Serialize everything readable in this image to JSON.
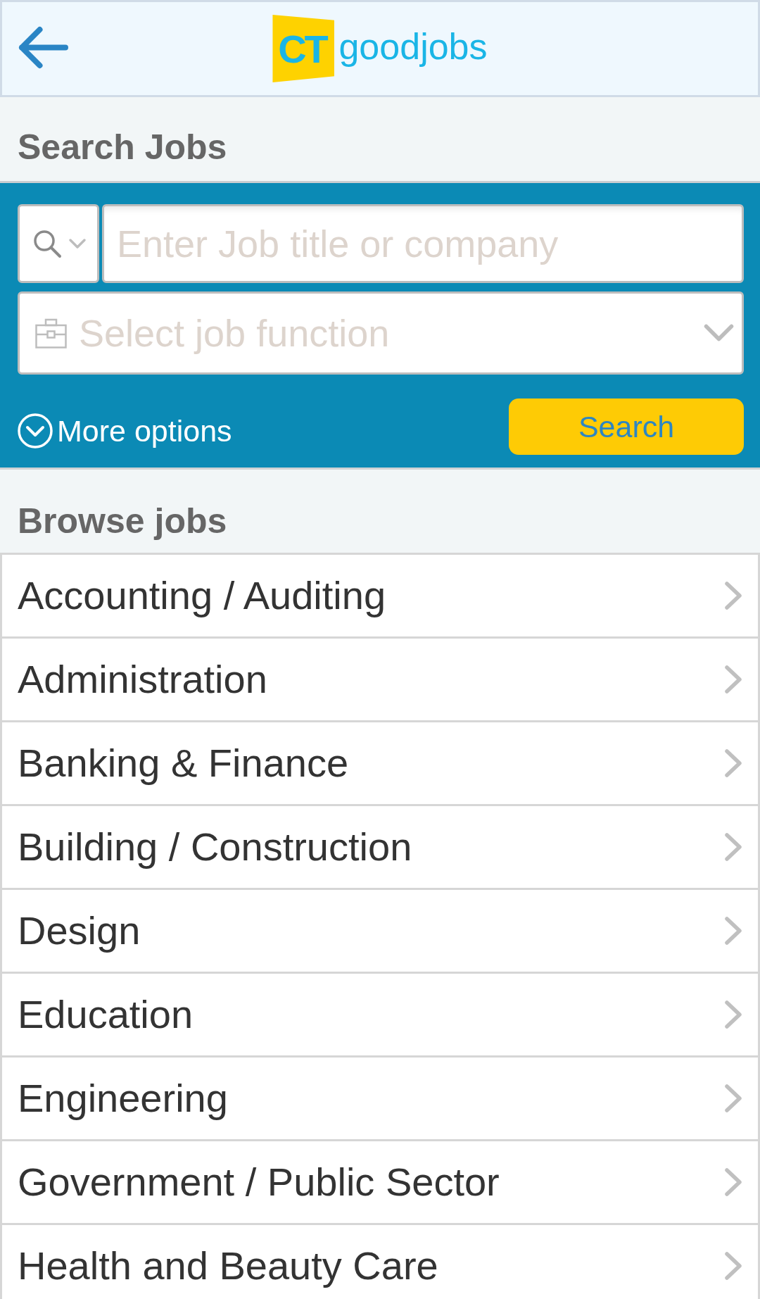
{
  "header": {
    "logo": {
      "mark": "CT",
      "wordmark": "goodjobs"
    }
  },
  "search_jobs": {
    "title": "Search Jobs",
    "keyword_field": {
      "placeholder": "Enter Job title or company"
    },
    "job_function_select": {
      "placeholder": "Select job function"
    },
    "more_options": "More options",
    "search_button": "Search"
  },
  "browse_jobs": {
    "title": "Browse jobs",
    "items": [
      {
        "label": "Accounting / Auditing"
      },
      {
        "label": "Administration"
      },
      {
        "label": "Banking & Finance"
      },
      {
        "label": "Building / Construction"
      },
      {
        "label": "Design"
      },
      {
        "label": "Education"
      },
      {
        "label": "Engineering"
      },
      {
        "label": "Government / Public Sector"
      },
      {
        "label": "Health and Beauty Care"
      }
    ]
  }
}
